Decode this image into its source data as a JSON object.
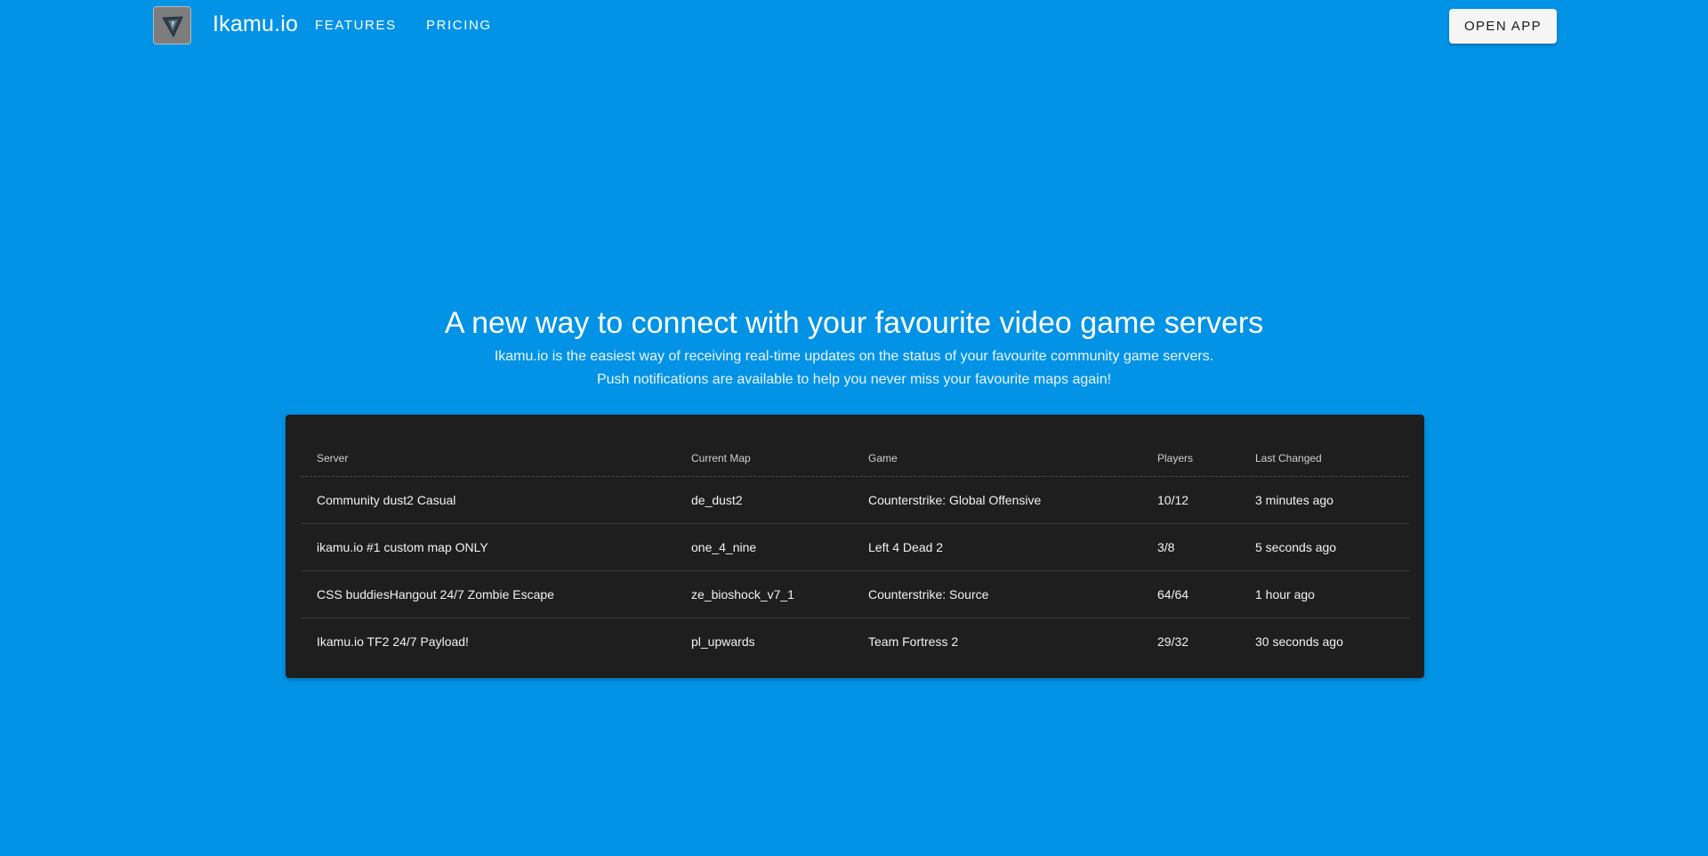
{
  "nav": {
    "brand": "Ikamu.io",
    "logo_icon": "arrowhead-logo-icon",
    "features": "FEATURES",
    "pricing": "PRICING",
    "open_app": "OPEN APP"
  },
  "hero": {
    "title": "A new way to connect with your favourite video game servers",
    "subtitle_line1": "Ikamu.io is the easiest way of receiving real-time updates on the status of your favourite community game servers.",
    "subtitle_line2": "Push notifications are available to help you never miss your favourite maps again!"
  },
  "table": {
    "headers": [
      "Server",
      "Current Map",
      "Game",
      "Players",
      "Last Changed"
    ],
    "rows": [
      [
        "Community dust2 Casual",
        "de_dust2",
        "Counterstrike: Global Offensive",
        "10/12",
        "3 minutes ago"
      ],
      [
        "ikamu.io #1 custom map ONLY",
        "one_4_nine",
        "Left 4 Dead 2",
        "3/8",
        "5 seconds ago"
      ],
      [
        "CSS buddiesHangout 24/7 Zombie Escape",
        "ze_bioshock_v7_1",
        "Counterstrike: Source",
        "64/64",
        "1 hour ago"
      ],
      [
        "Ikamu.io TF2 24/7 Payload!",
        "pl_upwards",
        "Team Fortress 2",
        "29/32",
        "30 seconds ago"
      ]
    ]
  },
  "colors": {
    "background": "#0293e6",
    "card": "#1e1e1e",
    "button": "#f5f5f5"
  }
}
